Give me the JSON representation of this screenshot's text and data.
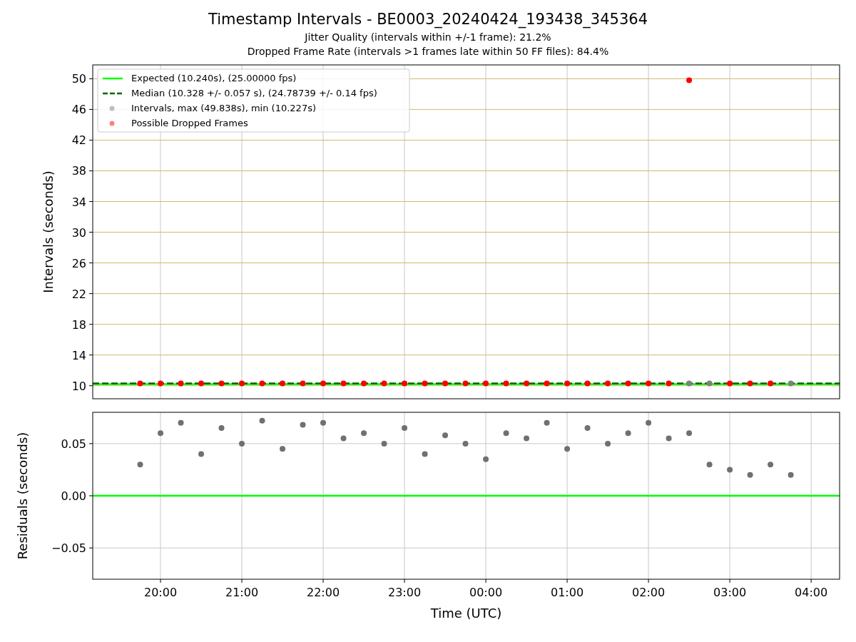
{
  "figure": {
    "title": "Timestamp Intervals - BE0003_20240424_193438_345364",
    "subtitles": [
      "Jitter Quality (intervals within +/-1 frame): 21.2%",
      "Dropped Frame Rate (intervals >1 frames late within 50 FF files): 84.4%"
    ]
  },
  "charts": [
    {
      "chart_data": {
        "type": "scatter",
        "ylabel": "Intervals (seconds)",
        "grid": true,
        "xlim": [
          "2024-04-24T19:10",
          "2024-04-25T04:21"
        ],
        "ylim": [
          8.3,
          51.8
        ],
        "yticks": [
          10,
          14,
          18,
          22,
          26,
          30,
          34,
          38,
          42,
          46,
          50
        ],
        "x": [
          "2024-04-24T19:45",
          "2024-04-24T20:00",
          "2024-04-24T20:15",
          "2024-04-24T20:30",
          "2024-04-24T20:45",
          "2024-04-24T21:00",
          "2024-04-24T21:15",
          "2024-04-24T21:30",
          "2024-04-24T21:45",
          "2024-04-24T22:00",
          "2024-04-24T22:15",
          "2024-04-24T22:30",
          "2024-04-24T22:45",
          "2024-04-24T23:00",
          "2024-04-24T23:15",
          "2024-04-24T23:30",
          "2024-04-24T23:45",
          "2024-04-25T00:00",
          "2024-04-25T00:15",
          "2024-04-25T00:30",
          "2024-04-25T00:45",
          "2024-04-25T01:00",
          "2024-04-25T01:15",
          "2024-04-25T01:30",
          "2024-04-25T01:45",
          "2024-04-25T02:00",
          "2024-04-25T02:15",
          "2024-04-25T02:30",
          "2024-04-25T02:45",
          "2024-04-25T03:00",
          "2024-04-25T03:15",
          "2024-04-25T03:30",
          "2024-04-25T03:45"
        ],
        "legend": true,
        "ref_lines": [
          {
            "axis": "y",
            "value": 10.2,
            "color": "#00ff00",
            "label": "Expected (10.240s), (25.00000 fps)"
          },
          {
            "axis": "y",
            "value": 10.3,
            "color": "#006400",
            "label": "Median (10.328 +/- 0.057 s), (24.78739 +/- 0.14 fps)"
          }
        ],
        "series": [
          {
            "name": "Intervals, max (49.838s), min (10.227s)",
            "color": "#808080",
            "values": [
              null,
              null,
              null,
              null,
              null,
              null,
              null,
              null,
              null,
              null,
              null,
              null,
              null,
              null,
              null,
              null,
              null,
              null,
              null,
              null,
              null,
              null,
              null,
              null,
              null,
              null,
              null,
              10.3,
              10.3,
              null,
              null,
              null,
              10.3
            ]
          },
          {
            "name": "Possible Dropped Frames",
            "color": "#ff0000",
            "values": [
              10.3,
              10.3,
              10.3,
              10.3,
              10.3,
              10.3,
              10.3,
              10.3,
              10.3,
              10.3,
              10.3,
              10.3,
              10.3,
              10.3,
              10.3,
              10.3,
              10.3,
              10.3,
              10.3,
              10.3,
              10.3,
              10.3,
              10.3,
              10.3,
              10.3,
              10.3,
              10.3,
              49.8,
              null,
              10.3,
              10.3,
              10.3,
              null
            ]
          }
        ]
      }
    },
    {
      "chart_data": {
        "type": "scatter",
        "xlabel": "Time (UTC)",
        "ylabel": "Residuals (seconds)",
        "grid": true,
        "xlim": [
          "2024-04-24T19:10",
          "2024-04-25T04:21"
        ],
        "ylim": [
          -0.08,
          0.08
        ],
        "xticks": [
          {
            "value": "2024-04-24T20:00",
            "label": "20:00"
          },
          {
            "value": "2024-04-24T21:00",
            "label": "21:00"
          },
          {
            "value": "2024-04-24T22:00",
            "label": "22:00"
          },
          {
            "value": "2024-04-24T23:00",
            "label": "23:00"
          },
          {
            "value": "2024-04-25T00:00",
            "label": "00:00"
          },
          {
            "value": "2024-04-25T01:00",
            "label": "01:00"
          },
          {
            "value": "2024-04-25T02:00",
            "label": "02:00"
          },
          {
            "value": "2024-04-25T03:00",
            "label": "03:00"
          },
          {
            "value": "2024-04-25T04:00",
            "label": "04:00"
          }
        ],
        "yticks": [
          {
            "value": -0.05,
            "label": "−0.05"
          },
          {
            "value": 0,
            "label": "0.00"
          },
          {
            "value": 0.05,
            "label": "0.05"
          }
        ],
        "x": [
          "2024-04-24T19:45",
          "2024-04-24T20:00",
          "2024-04-24T20:15",
          "2024-04-24T20:30",
          "2024-04-24T20:45",
          "2024-04-24T21:00",
          "2024-04-24T21:15",
          "2024-04-24T21:30",
          "2024-04-24T21:45",
          "2024-04-24T22:00",
          "2024-04-24T22:15",
          "2024-04-24T22:30",
          "2024-04-24T22:45",
          "2024-04-24T23:00",
          "2024-04-24T23:15",
          "2024-04-24T23:30",
          "2024-04-24T23:45",
          "2024-04-25T00:00",
          "2024-04-25T00:15",
          "2024-04-25T00:30",
          "2024-04-25T00:45",
          "2024-04-25T01:00",
          "2024-04-25T01:15",
          "2024-04-25T01:30",
          "2024-04-25T01:45",
          "2024-04-25T02:00",
          "2024-04-25T02:15",
          "2024-04-25T02:30",
          "2024-04-25T02:45",
          "2024-04-25T03:00",
          "2024-04-25T03:15",
          "2024-04-25T03:30",
          "2024-04-25T03:45"
        ],
        "ref_lines": [
          {
            "axis": "y",
            "value": 0,
            "color": "#00ff00"
          }
        ],
        "series": [
          {
            "color": "#707070",
            "values": [
              0.03,
              0.06,
              0.07,
              0.04,
              0.065,
              0.05,
              0.072,
              0.045,
              0.068,
              0.07,
              0.055,
              0.06,
              0.05,
              0.065,
              0.04,
              0.058,
              0.05,
              0.035,
              0.06,
              0.055,
              0.07,
              0.045,
              0.065,
              0.05,
              0.06,
              0.07,
              0.055,
              0.06,
              0.03,
              0.025,
              0.02,
              0.03,
              0.02
            ]
          }
        ]
      }
    }
  ]
}
